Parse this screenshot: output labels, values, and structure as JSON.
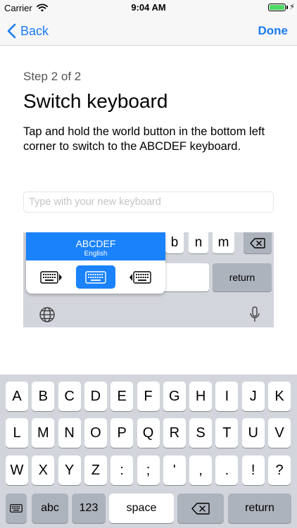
{
  "status_bar": {
    "carrier": "Carrier",
    "time": "9:04 AM"
  },
  "nav": {
    "back_label": "Back",
    "done_label": "Done"
  },
  "content": {
    "step": "Step 2 of 2",
    "title": "Switch keyboard",
    "description": "Tap and hold the world button in the bottom left corner to switch to the ABCDEF keyboard.",
    "input_placeholder": "Type with your new keyboard"
  },
  "illustration": {
    "keys": [
      "b",
      "n",
      "m"
    ],
    "return_label": "return",
    "popup": {
      "keyboard_name": "ABCDEF",
      "language": "English",
      "selected_layout": "full"
    }
  },
  "keyboard": {
    "row1": [
      "A",
      "B",
      "C",
      "D",
      "E",
      "F",
      "G",
      "H",
      "I",
      "J",
      "K"
    ],
    "row2": [
      "L",
      "M",
      "N",
      "O",
      "P",
      "Q",
      "R",
      "S",
      "T",
      "U",
      "V"
    ],
    "row3": [
      "W",
      "X",
      "Y",
      "Z",
      ":",
      ";",
      "'",
      ",",
      ".",
      "!",
      "?"
    ],
    "bottom": {
      "abc": "abc",
      "numbers": "123",
      "space": "space",
      "return": "return"
    }
  },
  "colors": {
    "accent": "#1a82fb",
    "link": "#1a7bf2",
    "keyboard_bg": "#d2d5db",
    "gray_key": "#adb3bc"
  }
}
